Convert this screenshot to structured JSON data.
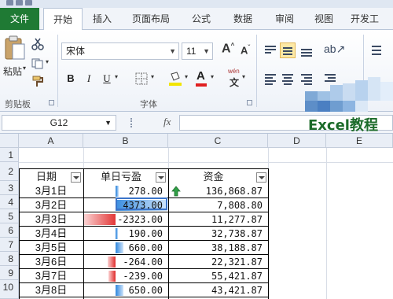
{
  "ribbon_tabs": [
    "文件",
    "开始",
    "插入",
    "页面布局",
    "公式",
    "数据",
    "审阅",
    "视图",
    "开发工"
  ],
  "clipboard": {
    "paste_label": "粘贴",
    "group_label": "剪贴板"
  },
  "font": {
    "name": "宋体",
    "size": "11",
    "group_label": "字体",
    "bold": "B",
    "italic": "I",
    "underline": "U",
    "font_color_glyph": "A",
    "phonetic_glyph": "wén"
  },
  "name_box": {
    "value": "G12"
  },
  "formula_bar": {
    "fx_label": "fx",
    "value": ""
  },
  "watermark": "Excel教程",
  "grid": {
    "columns": [
      "A",
      "B",
      "C",
      "D",
      "E"
    ],
    "rows": [
      "1",
      "2",
      "3",
      "4",
      "5",
      "6",
      "7",
      "8",
      "9",
      "10"
    ],
    "table_headers": [
      "日期",
      "单日亏盈",
      "资金"
    ]
  },
  "table_rows": [
    {
      "date": "3月1日",
      "daily": "278.00",
      "daily_value": 278,
      "funds": "136,868.87",
      "icon": "green-up-arrow"
    },
    {
      "date": "3月2日",
      "daily": "4373.00",
      "daily_value": 4373,
      "funds": "7,808.80"
    },
    {
      "date": "3月3日",
      "daily": "-2323.00",
      "daily_value": -2323,
      "funds": "11,277.87"
    },
    {
      "date": "3月4日",
      "daily": "190.00",
      "daily_value": 190,
      "funds": "32,738.87"
    },
    {
      "date": "3月5日",
      "daily": "660.00",
      "daily_value": 660,
      "funds": "38,188.87"
    },
    {
      "date": "3月6日",
      "daily": "-264.00",
      "daily_value": -264,
      "funds": "22,321.87"
    },
    {
      "date": "3月7日",
      "daily": "-239.00",
      "daily_value": -239,
      "funds": "55,421.87"
    },
    {
      "date": "3月8日",
      "daily": "650.00",
      "daily_value": 650,
      "funds": "43,421.87"
    }
  ],
  "colors": {
    "file_tab": "#1f7a34",
    "positive_bar": "#3d8fe0",
    "negative_bar": "#e33b3b",
    "watermark_text": "#1c6b2a"
  }
}
